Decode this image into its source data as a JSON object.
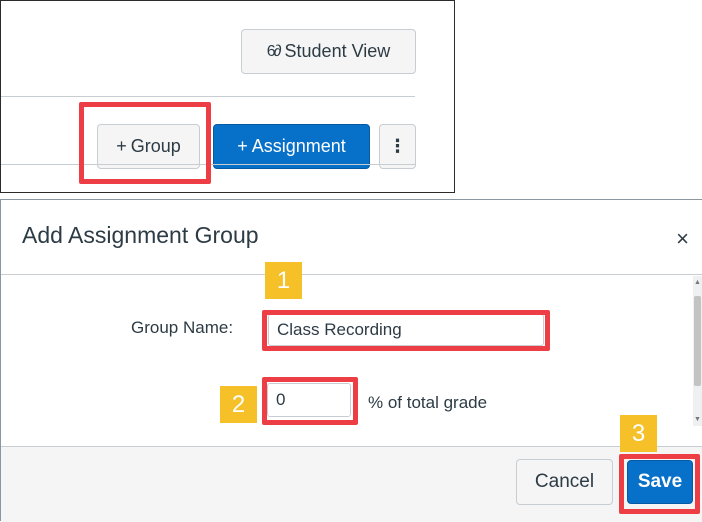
{
  "toolbar": {
    "student_view_icon": "glasses-icon",
    "student_view_glyph": "6∂",
    "student_view_label": "Student View",
    "group_glyph": "+",
    "group_label": "Group",
    "assignment_glyph": "+",
    "assignment_label": "Assignment",
    "more_glyph": "⋮"
  },
  "dialog": {
    "title": "Add Assignment Group",
    "close_glyph": "×",
    "group_name_label": "Group Name:",
    "group_name_value": "Class Recording",
    "percent_value": "0",
    "percent_label": "% of total grade",
    "cancel_label": "Cancel",
    "save_label": "Save"
  },
  "annotations": {
    "badge_1": "1",
    "badge_2": "2",
    "badge_3": "3",
    "highlight_color": "#ee3e45",
    "badge_color": "#f6c028"
  },
  "colors": {
    "primary": "#0770c9",
    "text": "#2d3b45"
  }
}
